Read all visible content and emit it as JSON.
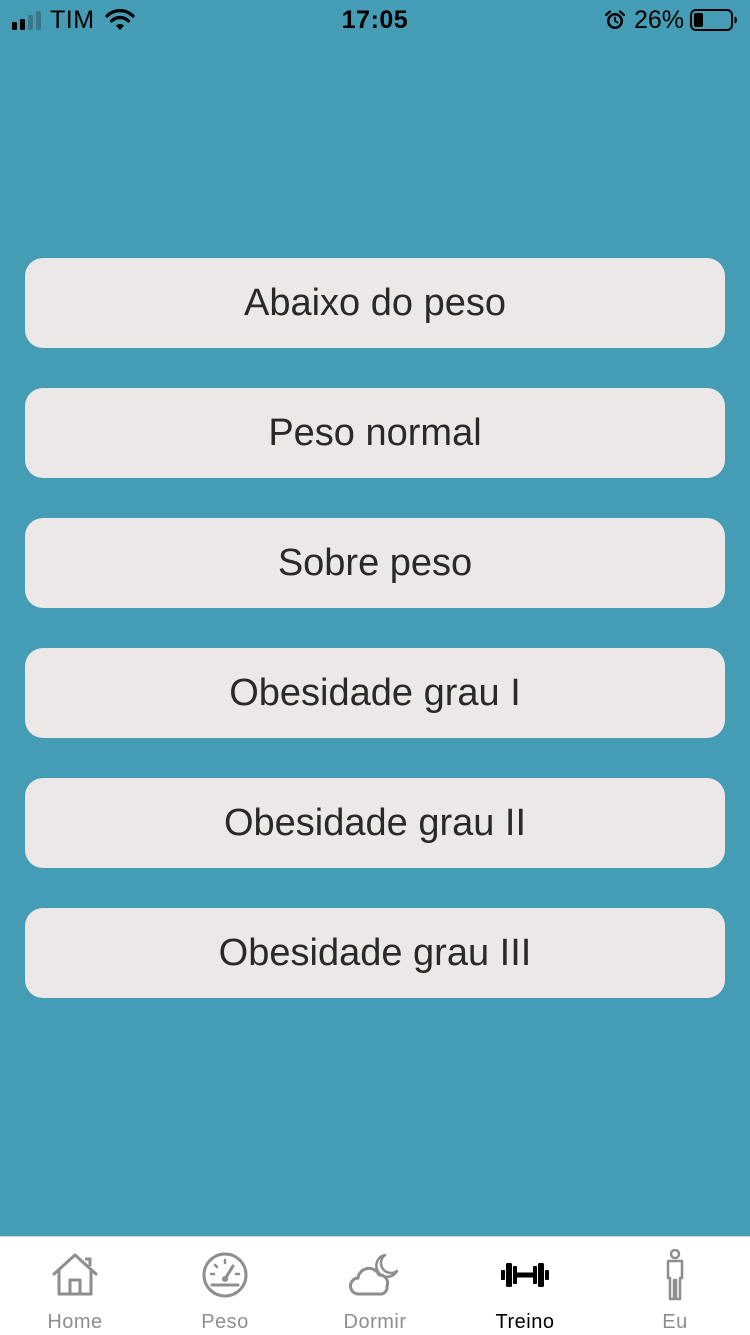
{
  "status_bar": {
    "carrier": "TIM",
    "time": "17:05",
    "battery_percent": "26%"
  },
  "options": [
    {
      "label": "Abaixo do peso"
    },
    {
      "label": "Peso normal"
    },
    {
      "label": "Sobre peso"
    },
    {
      "label": "Obesidade grau I"
    },
    {
      "label": "Obesidade grau II"
    },
    {
      "label": "Obesidade grau III"
    }
  ],
  "tabs": [
    {
      "label": "Home",
      "icon": "house-icon"
    },
    {
      "label": "Peso",
      "icon": "speedometer-icon"
    },
    {
      "label": "Dormir",
      "icon": "cloud-moon-icon"
    },
    {
      "label": "Treino",
      "icon": "dumbbell-icon",
      "active": true
    },
    {
      "label": "Eu",
      "icon": "person-icon"
    }
  ],
  "colors": {
    "background": "#449db5",
    "button": "#ece8e8",
    "button_text": "#2a2828",
    "tab_inactive": "#8e8e8e",
    "tab_active": "#000000"
  }
}
